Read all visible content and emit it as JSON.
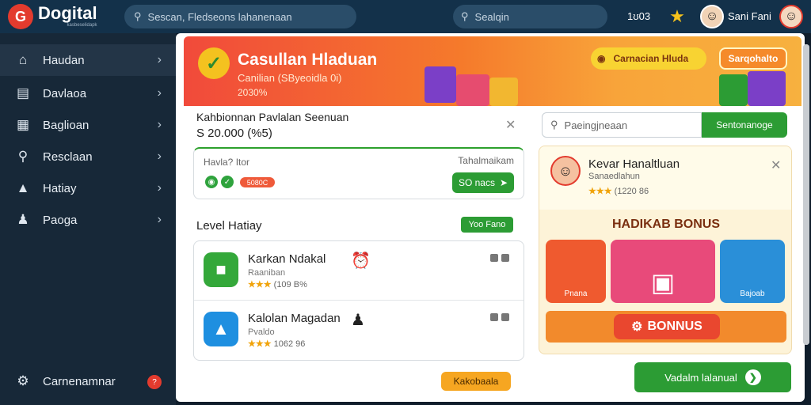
{
  "topbar": {
    "brand": "Dogital",
    "brand_sub": "kasbeselidapk",
    "search_placeholder": "Sescan, Fledseons lahanenaan",
    "search2_placeholder": "Sealqin",
    "count": "1ʊ03",
    "user_name": "Sani Fani",
    "star_icon": "star-icon",
    "avatar_icon": "avatar"
  },
  "sidebar": {
    "items": [
      {
        "label": "Haudan",
        "icon": "home-icon"
      },
      {
        "label": "Davlaoa",
        "icon": "book-icon"
      },
      {
        "label": "Baglioan",
        "icon": "gallery-icon"
      },
      {
        "label": "Resclaan",
        "icon": "key-icon"
      },
      {
        "label": "Hatiay",
        "icon": "cap-icon"
      },
      {
        "label": "Paoga",
        "icon": "people-icon"
      }
    ],
    "footer_label": "Carnenamnar",
    "footer_badge": "?"
  },
  "banner": {
    "title": "Casullan Hladuan",
    "subtitle": "Canilian (SByeoidla 0i)",
    "small": "2030%",
    "pill_label": "Carnacian Hluda",
    "button_label": "Sarqohalto"
  },
  "card1": {
    "title": "Kahbionnan Pavlalan Seenuan",
    "amount": "S 20.000 (%5)"
  },
  "panel": {
    "left_label": "Havla? Itor",
    "right_label": "Tahalmaikam",
    "chip_text": "5080C",
    "button_label": "SO nacs"
  },
  "levels": {
    "title": "Level Hatiay",
    "button_label": "Yoo Fano",
    "rows": [
      {
        "title": "Karkan Ndakal",
        "sub": "Raaniban",
        "stars": "★★★",
        "rating": "(109 B%",
        "icon_color": "#34a83a"
      },
      {
        "title": "Kalolan Magadan",
        "sub": "Pvaldo",
        "stars": "★★★",
        "rating": "1062 96",
        "icon_color": "#1e8fe0"
      }
    ]
  },
  "bottom_button": "Kakobaala",
  "right_search": {
    "placeholder": "Paeingjneaan",
    "button_label": "Sentonanoge"
  },
  "promo": {
    "name": "Kevar Hanaltluan",
    "sub": "Sanaedlahun",
    "stars": "★★★",
    "rating": "(1220 86",
    "heading": "HADIKAB BONUS",
    "tiles": [
      {
        "label": "Pnana",
        "color": "#ef5a2f"
      },
      {
        "label": "",
        "color": "#e84a7a"
      },
      {
        "label": "Bajoab",
        "color": "#2a8fd8"
      }
    ],
    "bonus_label": "BONNUS"
  },
  "cta": {
    "label": "Vadalm lalanual"
  }
}
